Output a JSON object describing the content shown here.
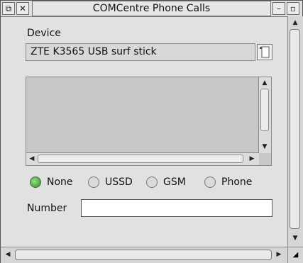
{
  "window": {
    "title": "COMCentre Phone Calls",
    "back_icon": "back-icon",
    "close_icon": "close-icon",
    "iconise_icon": "iconise-icon",
    "toggle_size_icon": "toggle-size-icon"
  },
  "device": {
    "label": "Device",
    "selected": "ZTE K3565 USB surf stick",
    "menu_icon": "popup-menu-icon"
  },
  "list": {
    "items": []
  },
  "mode": {
    "options": [
      {
        "label": "None",
        "selected": true
      },
      {
        "label": "USSD",
        "selected": false
      },
      {
        "label": "GSM",
        "selected": false
      },
      {
        "label": "Phone",
        "selected": false
      }
    ]
  },
  "number": {
    "label": "Number",
    "value": ""
  },
  "colors": {
    "radio_selected": "#55b545",
    "desktop": "#b9d6b4"
  }
}
